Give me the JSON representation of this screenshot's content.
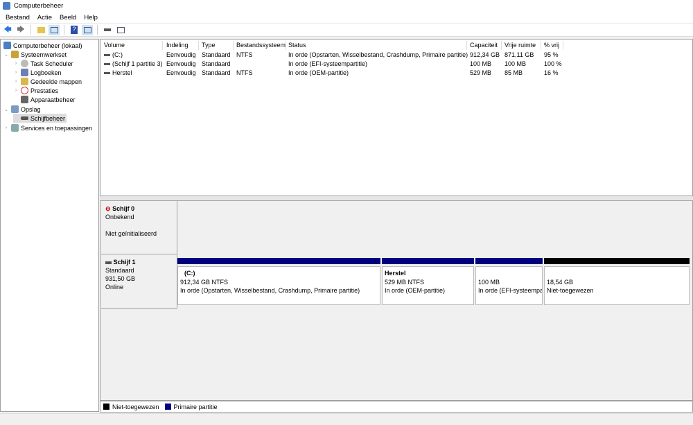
{
  "window": {
    "title": "Computerbeheer"
  },
  "menu": [
    "Bestand",
    "Actie",
    "Beeld",
    "Help"
  ],
  "toolbar": [
    "back-icon",
    "forward-icon",
    "up-folder-icon",
    "show-hide-tree-icon",
    "help-icon",
    "action-pane-icon",
    "disk-icon",
    "properties-icon"
  ],
  "tree": {
    "root": "Computerbeheer (lokaal)",
    "systeem": "Systeemwerkset",
    "task": "Task Scheduler",
    "log": "Logboeken",
    "shared": "Gedeelde mappen",
    "perf": "Prestaties",
    "device": "Apparaatbeheer",
    "storage": "Opslag",
    "disk": "Schijfbeheer",
    "services": "Services en toepassingen"
  },
  "table": {
    "columns": [
      "Volume",
      "Indeling",
      "Type",
      "Bestandssysteem",
      "Status",
      "Capaciteit",
      "Vrije ruimte",
      "% vrij"
    ],
    "rows": [
      [
        "(C:)",
        "Eenvoudig",
        "Standaard",
        "NTFS",
        "In orde (Opstarten, Wisselbestand, Crashdump, Primaire partitie)",
        "912,34 GB",
        "871,11 GB",
        "95 %"
      ],
      [
        "(Schijf 1 partitie 3)",
        "Eenvoudig",
        "Standaard",
        "",
        "In orde (EFI-systeempartitie)",
        "100 MB",
        "100 MB",
        "100 %"
      ],
      [
        "Herstel",
        "Eenvoudig",
        "Standaard",
        "NTFS",
        "In orde (OEM-partitie)",
        "529 MB",
        "85 MB",
        "16 %"
      ]
    ]
  },
  "disks": [
    {
      "name": "Schijf 0",
      "type": "Onbekend",
      "size": "",
      "state": "Niet geïnitialiseerd"
    },
    {
      "name": "Schijf 1",
      "type": "Standaard",
      "size": "931,50 GB",
      "state": "Online",
      "partitions": [
        {
          "title": "(C:)",
          "size": "912,34 GB NTFS",
          "status": "In orde (Opstarten, Wisselbestand, Crashdump, Primaire partitie)",
          "kind": "primary"
        },
        {
          "title": "Herstel",
          "size": "529 MB NTFS",
          "status": "In orde (OEM-partitie)",
          "kind": "primary"
        },
        {
          "title": "",
          "size": "100 MB",
          "status": "In orde (EFI-systeempartitie)",
          "kind": "primary"
        },
        {
          "title": "",
          "size": "18,54 GB",
          "status": "Niet-toegewezen",
          "kind": "unallocated"
        }
      ]
    }
  ],
  "legend": {
    "unallocated": "Niet-toegewezen",
    "primary": "Primaire partitie"
  },
  "colors": {
    "primary": "#00007f",
    "unallocated": "#000000"
  }
}
